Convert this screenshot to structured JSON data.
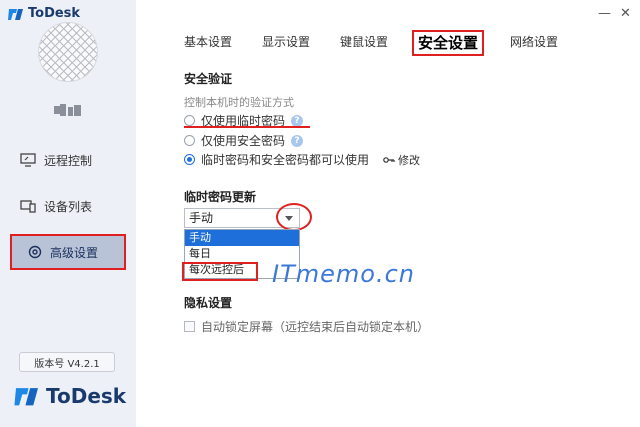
{
  "app": {
    "name": "ToDesk",
    "version": "版本号 V4.2.1"
  },
  "sidebar": {
    "items": [
      {
        "label": "远程控制",
        "icon": "monitor-icon"
      },
      {
        "label": "设备列表",
        "icon": "devices-icon"
      },
      {
        "label": "高级设置",
        "icon": "gear-icon",
        "active": true
      }
    ]
  },
  "window_controls": {
    "minimize": "—",
    "close": "✕"
  },
  "tabs": [
    {
      "label": "基本设置"
    },
    {
      "label": "显示设置"
    },
    {
      "label": "键鼠设置"
    },
    {
      "label": "安全设置",
      "active": true
    },
    {
      "label": "网络设置"
    }
  ],
  "security": {
    "title": "安全验证",
    "hint": "控制本机时的验证方式",
    "options": [
      {
        "label": "仅使用临时密码",
        "checked": false
      },
      {
        "label": "仅使用安全密码",
        "checked": false
      },
      {
        "label": "临时密码和安全密码都可以使用",
        "checked": true
      }
    ],
    "help": "?",
    "modify_label": "修改"
  },
  "temp_password": {
    "title": "临时密码更新",
    "selected": "手动",
    "options": [
      "手动",
      "每日",
      "每次远控后"
    ]
  },
  "watermark": "ITmemo.cn",
  "privacy": {
    "title": "隐私设置",
    "auto_lock_label": "自动锁定屏幕（远控结束后自动锁定本机）",
    "auto_lock_checked": false
  },
  "colors": {
    "accent": "#1f6fe0",
    "annotation_red": "#e02020",
    "sidebar_bg": "#edf1f7",
    "brand_blue": "#1a3a6e"
  }
}
